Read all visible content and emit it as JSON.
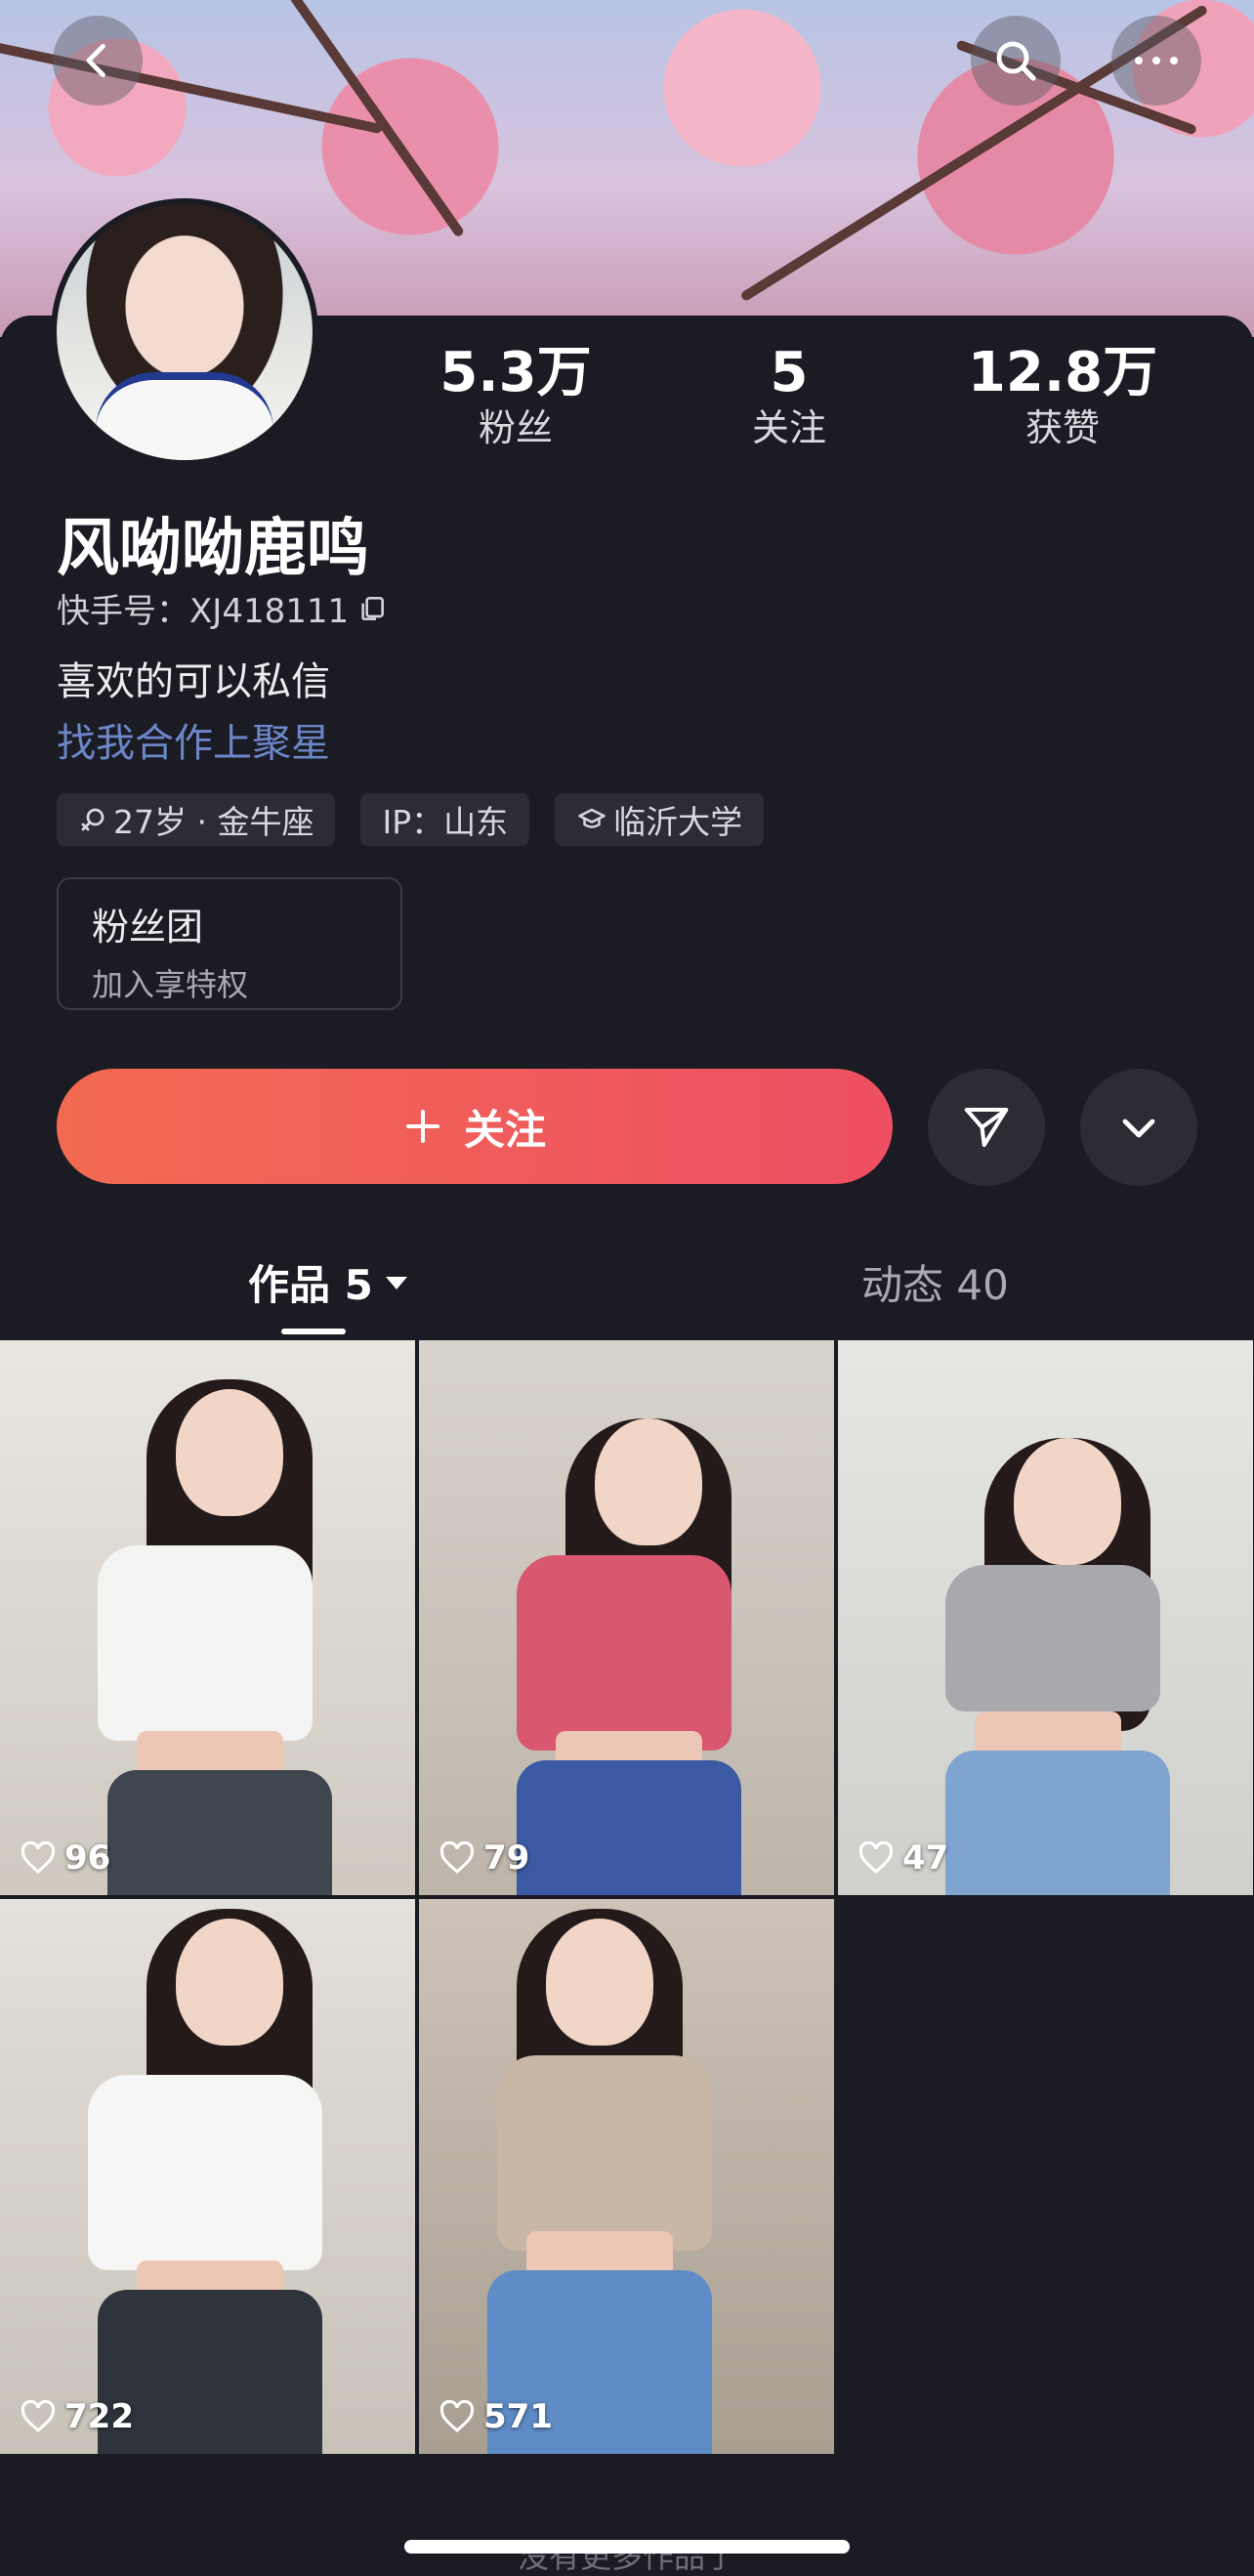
{
  "profile": {
    "name": "风呦呦鹿鸣",
    "kuaishou_id": "快手号：XJ418111",
    "bio_line1": "喜欢的可以私信",
    "bio_link": "找我合作上聚星",
    "stats": [
      {
        "value": "5.3万",
        "label": "粉丝"
      },
      {
        "value": "5",
        "label": "关注"
      },
      {
        "value": "12.8万",
        "label": "获赞"
      }
    ],
    "tags": [
      {
        "icon": "gender-female-icon",
        "text": "27岁 · 金牛座"
      },
      {
        "icon": "",
        "text": "IP：山东"
      },
      {
        "icon": "graduation-cap-icon",
        "text": "临沂大学"
      }
    ],
    "fan_club": {
      "title": "粉丝团",
      "subtitle": "加入享特权"
    }
  },
  "actions": {
    "follow_label": "关注"
  },
  "tabs": [
    {
      "label": "作品 5",
      "active": true
    },
    {
      "label": "动态 40",
      "active": false
    }
  ],
  "works": [
    {
      "likes": "96",
      "top_color": "#f4f4f2",
      "jeans_color": "#3f4650",
      "bg_color": "#d9d6d0"
    },
    {
      "likes": "79",
      "top_color": "#d9576f",
      "jeans_color": "#3b5aa3",
      "bg_color": "#cfc8bf"
    },
    {
      "likes": "47",
      "top_color": "#a9a9ad",
      "jeans_color": "#7fa4d0",
      "bg_color": "#dcdcd8"
    },
    {
      "likes": "722",
      "top_color": "#f6f6f4",
      "jeans_color": "#2f343c",
      "bg_color": "#d5d0c9"
    },
    {
      "likes": "571",
      "top_color": "#c9b7a6",
      "jeans_color": "#5f8cc7",
      "bg_color": "#c2b7ab"
    }
  ],
  "footer": "没有更多作品了",
  "colors": {
    "background": "#1b1b23",
    "follow_start": "#f26a52",
    "follow_end": "#ee4f63",
    "link": "#6c86c9"
  }
}
